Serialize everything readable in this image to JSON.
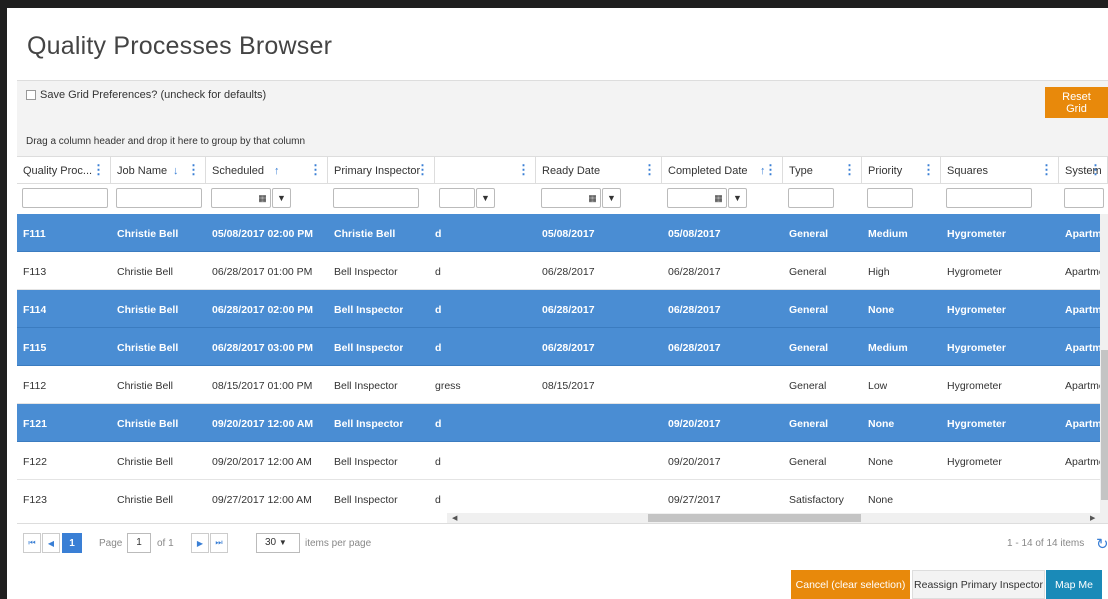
{
  "title": "Quality Processes Browser",
  "toolbar": {
    "save_pref_label": "Save Grid Preferences? (uncheck for defaults)",
    "reset_label": "Reset Grid"
  },
  "grouping_hint": "Drag a column header and drop it here to group by that column",
  "columns": [
    {
      "label": "Quality Proc...",
      "sort": ""
    },
    {
      "label": "Job Name",
      "sort": "↓"
    },
    {
      "label": "Scheduled",
      "sort": "↑"
    },
    {
      "label": "Primary Inspector",
      "sort": ""
    },
    {
      "label": "",
      "sort": ""
    },
    {
      "label": "Ready Date",
      "sort": ""
    },
    {
      "label": "Completed Date",
      "sort": "↑"
    },
    {
      "label": "Type",
      "sort": ""
    },
    {
      "label": "Priority",
      "sort": ""
    },
    {
      "label": "Squares",
      "sort": ""
    },
    {
      "label": "System",
      "sort": ""
    }
  ],
  "rows": [
    {
      "selected": true,
      "cells": [
        "F111",
        "Christie Bell",
        "05/08/2017 02:00 PM",
        "Christie Bell",
        "d",
        "05/08/2017",
        "05/08/2017",
        "General",
        "Medium",
        "Hygrometer",
        "Apartme"
      ]
    },
    {
      "selected": false,
      "cells": [
        "F113",
        "Christie Bell",
        "06/28/2017 01:00 PM",
        "Bell Inspector",
        "d",
        "06/28/2017",
        "06/28/2017",
        "General",
        "High",
        "Hygrometer",
        "Apartme"
      ]
    },
    {
      "selected": true,
      "cells": [
        "F114",
        "Christie Bell",
        "06/28/2017 02:00 PM",
        "Bell Inspector",
        "d",
        "06/28/2017",
        "06/28/2017",
        "General",
        "None",
        "Hygrometer",
        "Apartme"
      ]
    },
    {
      "selected": true,
      "cells": [
        "F115",
        "Christie Bell",
        "06/28/2017 03:00 PM",
        "Bell Inspector",
        "d",
        "06/28/2017",
        "06/28/2017",
        "General",
        "Medium",
        "Hygrometer",
        "Apartme"
      ]
    },
    {
      "selected": false,
      "cells": [
        "F112",
        "Christie Bell",
        "08/15/2017 01:00 PM",
        "Bell Inspector",
        "gress",
        "08/15/2017",
        "",
        "General",
        "Low",
        "Hygrometer",
        "Apartme"
      ]
    },
    {
      "selected": true,
      "cells": [
        "F121",
        "Christie Bell",
        "09/20/2017 12:00 AM",
        "Bell Inspector",
        "d",
        "",
        "09/20/2017",
        "General",
        "None",
        "Hygrometer",
        "Apartme"
      ]
    },
    {
      "selected": false,
      "cells": [
        "F122",
        "Christie Bell",
        "09/20/2017 12:00 AM",
        "Bell Inspector",
        "d",
        "",
        "09/20/2017",
        "General",
        "None",
        "Hygrometer",
        "Apartme"
      ]
    },
    {
      "selected": false,
      "cells": [
        "F123",
        "Christie Bell",
        "09/27/2017 12:00 AM",
        "Bell Inspector",
        "d",
        "",
        "09/27/2017",
        "Satisfactory",
        "None",
        "",
        ""
      ]
    }
  ],
  "pager": {
    "current_page": "1",
    "page_label": "Page",
    "page_value": "1",
    "of_label": "of 1",
    "page_size": "30",
    "items_per_page": "items per page",
    "summary": "1 - 14 of 14 items"
  },
  "actions": {
    "cancel": "Cancel (clear selection)",
    "reassign": "Reassign Primary Inspector",
    "map": "Map Me"
  },
  "colors": {
    "selected_row": "#4a8dd3",
    "accent": "#3a7fd5",
    "orange": "#e8890b",
    "teal": "#1a8ab8"
  }
}
